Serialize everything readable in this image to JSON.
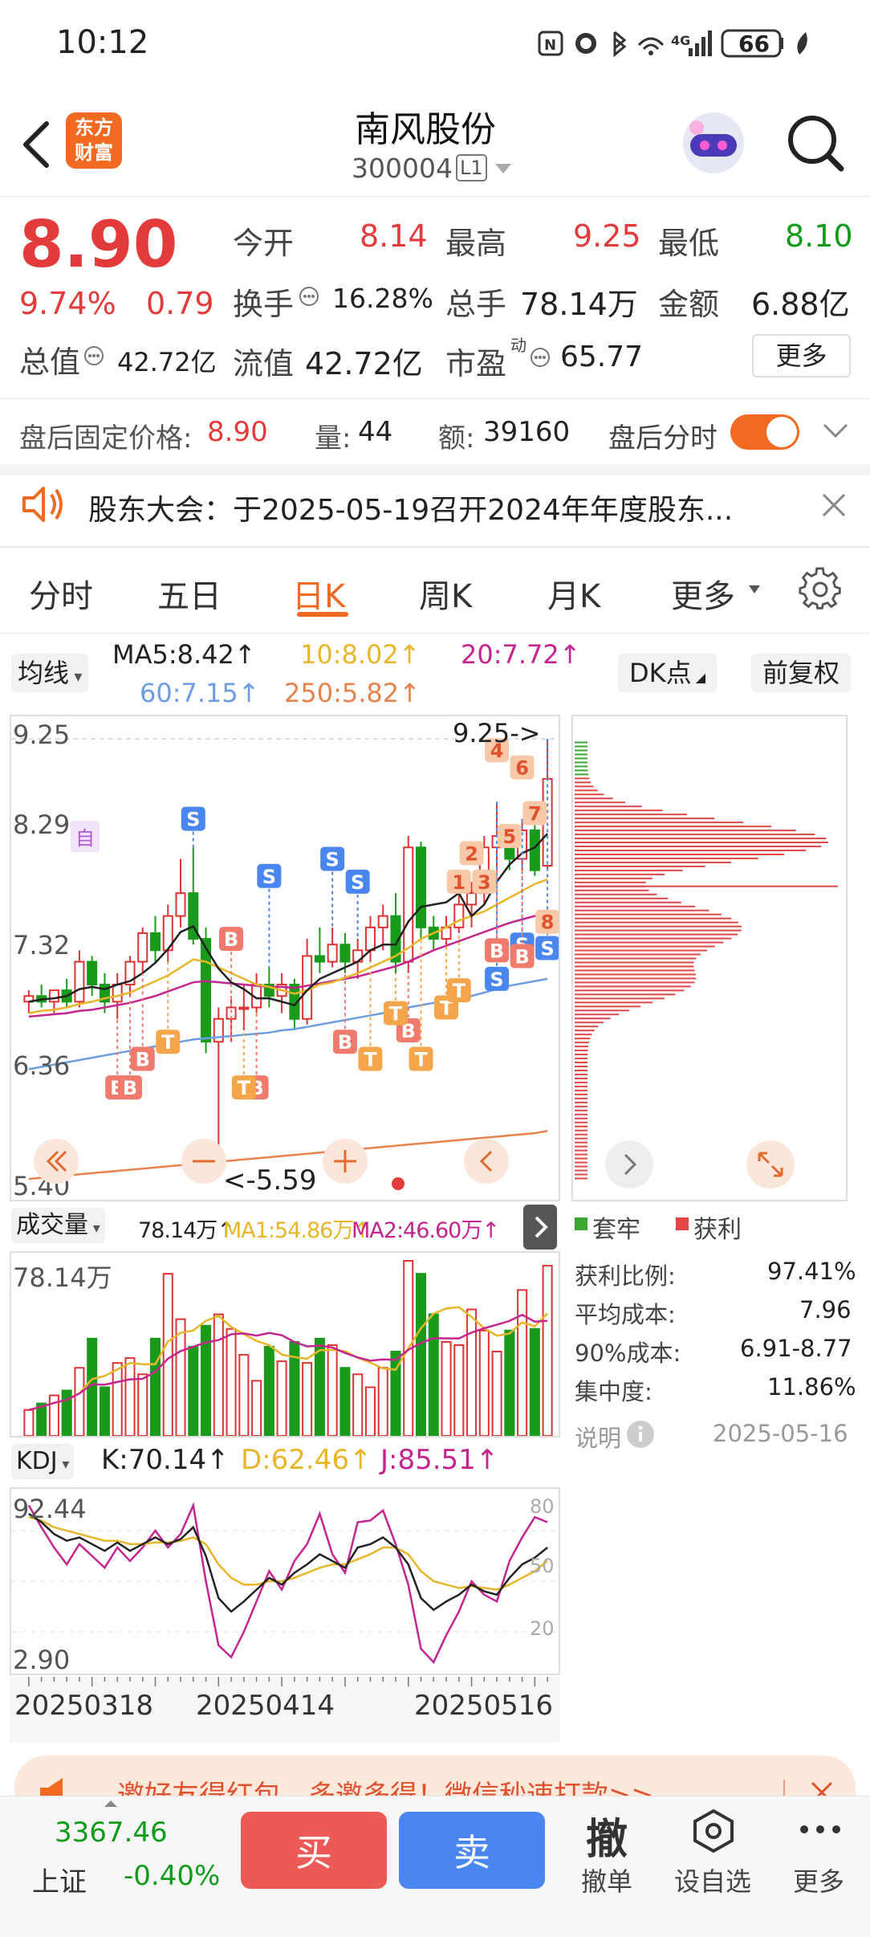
{
  "status_bar": {
    "time": "10:12",
    "battery": "66"
  },
  "header": {
    "title": "南风股份",
    "code": "300004",
    "level": "L1",
    "logo_line1": "东方",
    "logo_line2": "财富"
  },
  "quote": {
    "price": "8.90",
    "change_pct": "9.74%",
    "change": "0.79",
    "open_label": "今开",
    "open": "8.14",
    "high_label": "最高",
    "high": "9.25",
    "low_label": "最低",
    "low": "8.10",
    "turnover_label": "换手",
    "turnover": "16.28%",
    "volume_label": "总手",
    "volume": "78.14万",
    "amount_label": "金额",
    "amount": "6.88亿",
    "mcap_label": "总值",
    "mcap": "42.72亿",
    "float_label": "流值",
    "float": "42.72亿",
    "pe_label": "市盈",
    "pe_sup": "动",
    "pe": "65.77",
    "more_label": "更多"
  },
  "afterhours": {
    "price_label": "盘后固定价格:",
    "price": "8.90",
    "vol_label": "量:",
    "vol": "44",
    "amt_label": "额:",
    "amt": "39160",
    "toggle_label": "盘后分时"
  },
  "notice": {
    "text": "股东大会：于2025-05-19召开2024年年度股东..."
  },
  "tabs": [
    "分时",
    "五日",
    "日K",
    "周K",
    "月K",
    "更多"
  ],
  "active_tab": "日K",
  "ma_bar": {
    "selector": "均线",
    "ma5": "MA5:8.42↑",
    "ma10": "10:8.02↑",
    "ma20": "20:7.72↑",
    "ma60": "60:7.15↑",
    "ma250": "250:5.82↑",
    "dk": "DK点",
    "fq": "前复权"
  },
  "kline": {
    "y_labels": [
      "9.25",
      "8.29",
      "7.32",
      "6.36",
      "5.40"
    ],
    "high_marker": "9.25->",
    "low_marker": "<-5.59",
    "self_tag": "自",
    "candles": [
      [
        6.95,
        7.05,
        6.85,
        7.0
      ],
      [
        7.0,
        7.1,
        6.9,
        6.95
      ],
      [
        6.95,
        7.05,
        6.85,
        7.05
      ],
      [
        7.05,
        7.15,
        6.9,
        6.95
      ],
      [
        6.95,
        7.4,
        6.9,
        7.3
      ],
      [
        7.3,
        7.35,
        7.0,
        7.1
      ],
      [
        7.1,
        7.2,
        6.85,
        6.95
      ],
      [
        6.95,
        7.2,
        6.8,
        7.1
      ],
      [
        7.1,
        7.35,
        7.0,
        7.3
      ],
      [
        7.3,
        7.6,
        7.2,
        7.55
      ],
      [
        7.55,
        7.7,
        7.3,
        7.4
      ],
      [
        7.4,
        7.8,
        7.3,
        7.7
      ],
      [
        7.7,
        8.2,
        7.6,
        7.9
      ],
      [
        7.9,
        8.3,
        7.45,
        7.5
      ],
      [
        7.5,
        7.6,
        6.5,
        6.6
      ],
      [
        6.6,
        6.9,
        5.59,
        6.8
      ],
      [
        6.8,
        7.0,
        6.6,
        6.9
      ],
      [
        6.9,
        7.1,
        6.7,
        6.9
      ],
      [
        6.9,
        7.2,
        6.85,
        7.1
      ],
      [
        7.1,
        7.25,
        6.9,
        7.0
      ],
      [
        7.0,
        7.2,
        6.85,
        7.1
      ],
      [
        7.1,
        7.15,
        6.7,
        6.8
      ],
      [
        6.8,
        7.5,
        6.75,
        7.35
      ],
      [
        7.35,
        7.6,
        7.2,
        7.3
      ],
      [
        7.3,
        7.6,
        7.25,
        7.45
      ],
      [
        7.45,
        7.55,
        7.2,
        7.3
      ],
      [
        7.3,
        7.5,
        7.15,
        7.4
      ],
      [
        7.4,
        7.7,
        7.3,
        7.6
      ],
      [
        7.6,
        7.8,
        7.4,
        7.7
      ],
      [
        7.7,
        7.9,
        7.2,
        7.3
      ],
      [
        7.3,
        8.4,
        7.2,
        8.3
      ],
      [
        8.3,
        8.35,
        7.5,
        7.6
      ],
      [
        7.6,
        7.7,
        7.4,
        7.5
      ],
      [
        7.5,
        7.7,
        7.45,
        7.6
      ],
      [
        7.6,
        7.9,
        7.55,
        7.8
      ],
      [
        7.8,
        8.0,
        7.6,
        7.9
      ],
      [
        7.9,
        8.4,
        7.8,
        8.3
      ],
      [
        8.3,
        8.7,
        8.1,
        8.4
      ],
      [
        8.4,
        8.5,
        8.1,
        8.2
      ],
      [
        8.2,
        8.55,
        8.1,
        8.45
      ],
      [
        8.45,
        8.7,
        8.05,
        8.1
      ],
      [
        8.14,
        9.25,
        8.1,
        8.9
      ]
    ],
    "ma5": [
      6.95,
      6.97,
      6.98,
      7.0,
      7.06,
      7.08,
      7.06,
      7.1,
      7.13,
      7.2,
      7.29,
      7.41,
      7.56,
      7.61,
      7.42,
      7.24,
      7.12,
      7.06,
      6.98,
      6.98,
      6.95,
      6.92,
      7.05,
      7.15,
      7.2,
      7.25,
      7.3,
      7.4,
      7.45,
      7.45,
      7.65,
      7.78,
      7.8,
      7.82,
      7.9,
      7.7,
      7.8,
      8.0,
      8.15,
      8.25,
      8.3,
      8.42
    ],
    "ma10": [
      6.85,
      6.87,
      6.88,
      6.9,
      6.93,
      6.95,
      6.98,
      7.0,
      7.03,
      7.08,
      7.13,
      7.18,
      7.25,
      7.32,
      7.3,
      7.25,
      7.2,
      7.15,
      7.1,
      7.08,
      7.05,
      7.02,
      7.05,
      7.1,
      7.12,
      7.16,
      7.2,
      7.25,
      7.3,
      7.35,
      7.42,
      7.5,
      7.55,
      7.6,
      7.66,
      7.7,
      7.74,
      7.8,
      7.86,
      7.92,
      7.98,
      8.02
    ],
    "ma20": [
      6.82,
      6.83,
      6.84,
      6.85,
      6.87,
      6.88,
      6.9,
      6.92,
      6.94,
      6.97,
      7.0,
      7.04,
      7.08,
      7.12,
      7.13,
      7.12,
      7.11,
      7.1,
      7.09,
      7.08,
      7.08,
      7.07,
      7.09,
      7.11,
      7.13,
      7.15,
      7.17,
      7.2,
      7.23,
      7.26,
      7.3,
      7.35,
      7.4,
      7.44,
      7.48,
      7.52,
      7.56,
      7.6,
      7.64,
      7.67,
      7.7,
      7.72
    ],
    "ma60": [
      6.36,
      6.38,
      6.4,
      6.42,
      6.44,
      6.46,
      6.48,
      6.5,
      6.52,
      6.54,
      6.56,
      6.58,
      6.6,
      6.62,
      6.63,
      6.64,
      6.65,
      6.66,
      6.67,
      6.68,
      6.7,
      6.71,
      6.73,
      6.75,
      6.77,
      6.79,
      6.81,
      6.83,
      6.85,
      6.87,
      6.9,
      6.92,
      6.94,
      6.96,
      6.98,
      7.0,
      7.03,
      7.06,
      7.09,
      7.11,
      7.13,
      7.15
    ],
    "ma250": [
      5.4,
      5.41,
      5.42,
      5.43,
      5.44,
      5.45,
      5.46,
      5.47,
      5.48,
      5.49,
      5.5,
      5.51,
      5.52,
      5.53,
      5.54,
      5.55,
      5.56,
      5.57,
      5.58,
      5.59,
      5.6,
      5.61,
      5.62,
      5.63,
      5.64,
      5.65,
      5.66,
      5.67,
      5.68,
      5.69,
      5.7,
      5.71,
      5.72,
      5.73,
      5.74,
      5.75,
      5.76,
      5.77,
      5.78,
      5.79,
      5.8,
      5.82
    ],
    "ymin": 5.4,
    "ymax": 9.25,
    "tags": [
      [
        "S",
        13,
        8.55,
        "#4a86f0"
      ],
      [
        "S",
        19,
        8.05,
        "#4a86f0"
      ],
      [
        "S",
        24,
        8.2,
        "#4a86f0"
      ],
      [
        "S",
        26,
        8.0,
        "#4a86f0"
      ],
      [
        "S",
        37,
        7.15,
        "#4a86f0"
      ],
      [
        "S",
        39,
        7.45,
        "#4a86f0"
      ],
      [
        "S",
        41,
        7.42,
        "#4a86f0"
      ],
      [
        "B",
        16,
        7.5,
        "#f07a6e"
      ],
      [
        "B",
        25,
        6.6,
        "#f07a6e"
      ],
      [
        "B",
        30,
        6.7,
        "#f07a6e"
      ],
      [
        "B",
        7,
        6.2,
        "#f07a6e"
      ],
      [
        "B",
        8,
        6.2,
        "#f07a6e"
      ],
      [
        "B",
        9,
        6.45,
        "#f07a6e"
      ],
      [
        "B",
        18,
        6.2,
        "#f07a6e"
      ],
      [
        "B",
        37,
        7.4,
        "#f07a6e"
      ],
      [
        "B",
        39,
        7.35,
        "#f07a6e"
      ],
      [
        "T",
        11,
        6.6,
        "#f5a64b"
      ],
      [
        "T",
        17,
        6.2,
        "#f5a64b"
      ],
      [
        "T",
        27,
        6.45,
        "#f5a64b"
      ],
      [
        "T",
        29,
        6.85,
        "#f5a64b"
      ],
      [
        "T",
        31,
        6.45,
        "#f5a64b"
      ],
      [
        "T",
        33,
        6.9,
        "#f5a64b"
      ],
      [
        "T",
        34,
        7.05,
        "#f5a64b"
      ],
      [
        "1",
        34,
        8.0,
        "#f7c9a8"
      ],
      [
        "2",
        35,
        8.25,
        "#f7c9a8"
      ],
      [
        "3",
        36,
        8.0,
        "#f7c9a8"
      ],
      [
        "4",
        37,
        9.15,
        "#f7c9a8"
      ],
      [
        "5",
        38,
        8.4,
        "#f7c9a8"
      ],
      [
        "6",
        39,
        9.0,
        "#f7c9a8"
      ],
      [
        "7",
        40,
        8.6,
        "#f7c9a8"
      ],
      [
        "8",
        41,
        7.65,
        "#f7c9a8"
      ]
    ]
  },
  "chip": {
    "legend_hold": "套牢",
    "legend_profit": "获利",
    "profit_ratio_label": "获利比例:",
    "profit_ratio": "97.41%",
    "avg_cost_label": "平均成本:",
    "avg_cost": "7.96",
    "cost90_label": "90%成本:",
    "cost90": "6.91-8.77",
    "concentration_label": "集中度:",
    "concentration": "11.86%",
    "note_label": "说明",
    "date": "2025-05-16"
  },
  "volume_bar": {
    "selector": "成交量",
    "vol": "78.14万↑",
    "ma1": "MA1:54.86万↑",
    "ma2": "MA2:46.60万↑",
    "y_label": "78.14万",
    "values": [
      16,
      20,
      25,
      28,
      42,
      60,
      30,
      45,
      48,
      38,
      60,
      100,
      72,
      55,
      68,
      75,
      66,
      50,
      34,
      55,
      46,
      58,
      45,
      60,
      56,
      42,
      38,
      30,
      42,
      52,
      108,
      100,
      75,
      58,
      56,
      78,
      65,
      52,
      65,
      90,
      66,
      105
    ]
  },
  "kdj": {
    "selector": "KDJ",
    "k": "K:70.14↑",
    "d": "D:62.46↑",
    "j": "J:85.51↑",
    "y_top": "92.44",
    "y_bottom": "2.90",
    "lv80": "80",
    "lv50": "50",
    "lv20": "20",
    "kv": [
      90,
      85,
      78,
      74,
      76,
      72,
      68,
      73,
      68,
      72,
      76,
      72,
      75,
      82,
      65,
      40,
      32,
      38,
      45,
      52,
      48,
      55,
      60,
      66,
      62,
      58,
      70,
      72,
      76,
      70,
      60,
      40,
      33,
      38,
      42,
      48,
      44,
      42,
      52,
      60,
      64,
      70
    ],
    "dv": [
      88,
      86,
      82,
      80,
      78,
      76,
      74,
      74,
      72,
      72,
      73,
      73,
      74,
      76,
      72,
      60,
      52,
      48,
      48,
      50,
      50,
      52,
      55,
      58,
      60,
      60,
      63,
      66,
      70,
      70,
      66,
      56,
      50,
      48,
      46,
      47,
      46,
      45,
      48,
      52,
      56,
      62
    ],
    "jv": [
      95,
      82,
      70,
      60,
      72,
      65,
      58,
      70,
      62,
      70,
      80,
      70,
      78,
      95,
      50,
      12,
      5,
      20,
      38,
      56,
      45,
      62,
      72,
      90,
      66,
      55,
      85,
      86,
      92,
      72,
      48,
      10,
      2,
      18,
      32,
      50,
      42,
      38,
      62,
      76,
      88,
      85
    ],
    "dates": [
      "20250318",
      "20250414",
      "20250516"
    ]
  },
  "banner": {
    "text": "邀好友得红包，多邀多得！微信秒速打款>>"
  },
  "bottom": {
    "index_value": "3367.46",
    "index_name": "上证",
    "index_change": "-0.40%",
    "buy": "买",
    "sell": "卖",
    "cancel_icon": "撤",
    "cancel_label": "撤单",
    "fav_label": "设自选",
    "more_label": "更多"
  }
}
